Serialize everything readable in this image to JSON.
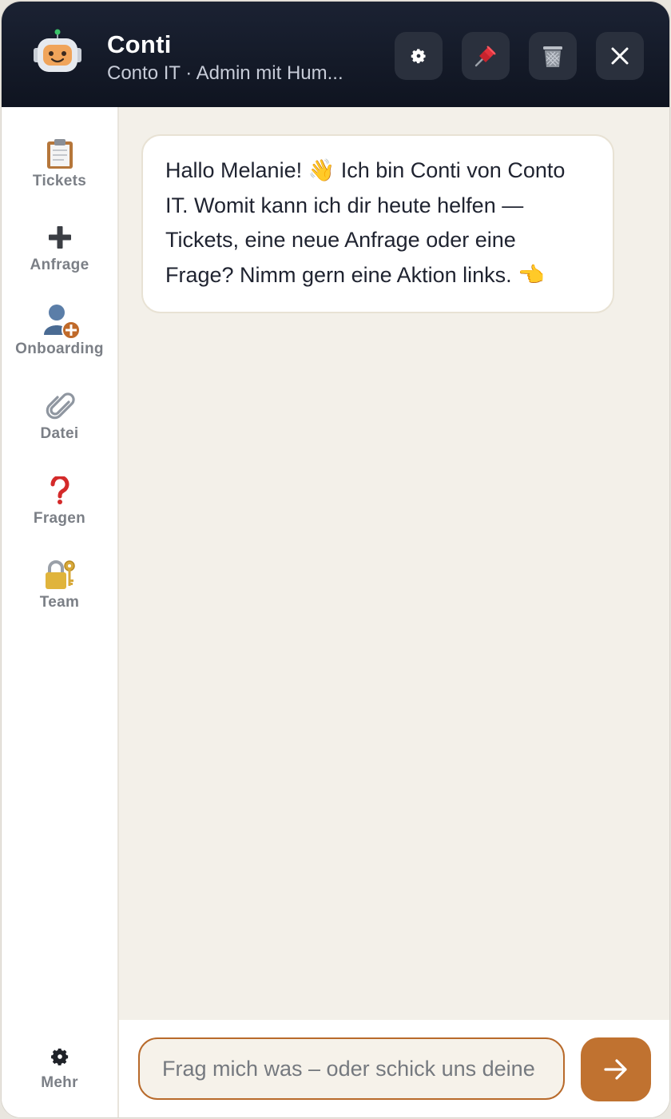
{
  "header": {
    "title": "Conti",
    "subtitle": "Conto IT · Admin mit Hum...",
    "buttons": {
      "settings": "gear-icon",
      "pin": "pushpin-icon",
      "delete": "trash-icon",
      "close": "close-icon"
    }
  },
  "sidebar": {
    "items": [
      {
        "label": "Tickets",
        "icon": "clipboard-icon"
      },
      {
        "label": "Anfrage",
        "icon": "plus-icon"
      },
      {
        "label": "Onboarding",
        "icon": "add-user-icon"
      },
      {
        "label": "Datei",
        "icon": "paperclip-icon"
      },
      {
        "label": "Fragen",
        "icon": "question-icon"
      },
      {
        "label": "Team",
        "icon": "lock-key-icon"
      }
    ],
    "more": {
      "label": "Mehr",
      "icon": "gear-icon"
    }
  },
  "chat": {
    "messages": [
      {
        "from": "bot",
        "text": "Hallo Melanie! 👋 Ich bin Conti von Conto IT. Womit kann ich dir heute helfen — Tickets, eine neue Anfrage oder eine Frage? Nimm gern eine Aktion links. 👈"
      }
    ]
  },
  "composer": {
    "placeholder": "Frag mich was – oder schick uns deine Datei",
    "send_icon": "arrow-right-icon"
  },
  "colors": {
    "header_bg": "#141a27",
    "accent": "#c07230",
    "chat_bg": "#f3f0e9"
  }
}
